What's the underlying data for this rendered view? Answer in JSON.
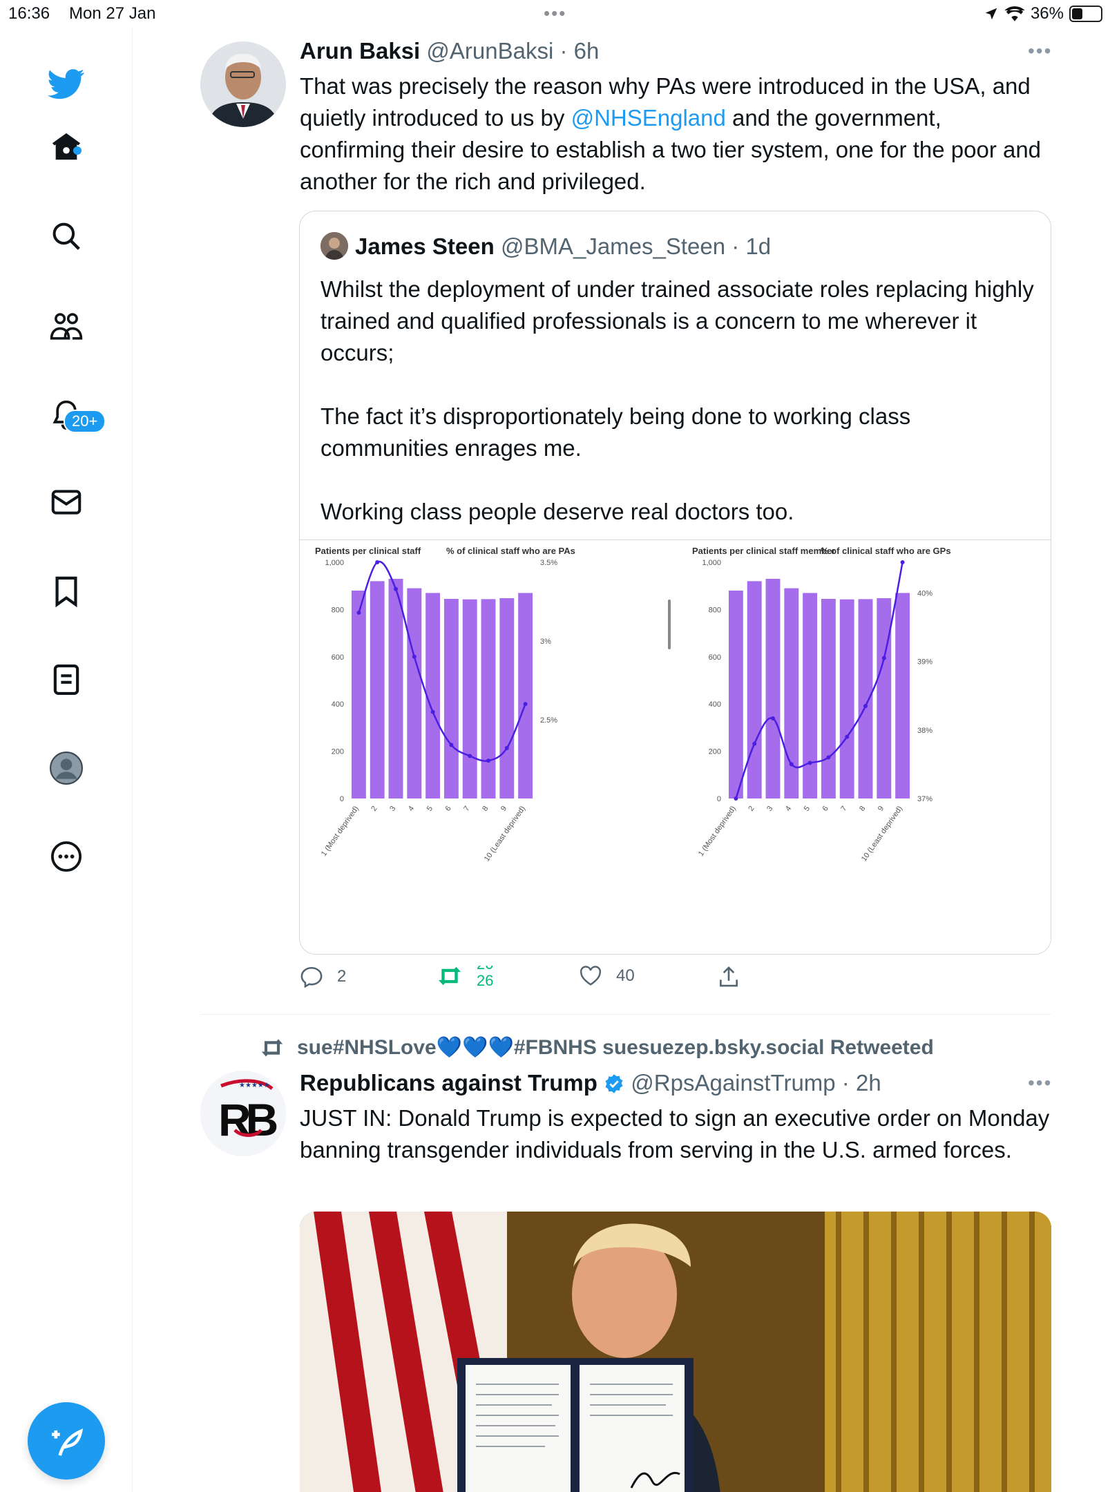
{
  "status_bar": {
    "time": "16:36",
    "date": "Mon 27 Jan",
    "battery": "36%",
    "battery_level": 0.36
  },
  "sidebar": {
    "notifications_badge": "20+",
    "items": [
      "home",
      "explore",
      "communities",
      "notifications",
      "messages",
      "bookmarks",
      "lists",
      "profile",
      "more"
    ]
  },
  "tweet1": {
    "name": "Arun Baksi",
    "handle": "@ArunBaksi",
    "time": "6h",
    "text_1": "That was precisely the reason why PAs were introduced in the USA, and quietly introduced to us by ",
    "mention": "@NHSEngland",
    "text_2": " and the government, confirming their desire to establish a two tier system, one for the poor and another for the rich and privileged.",
    "quote": {
      "name": "James Steen",
      "handle": "@BMA_James_Steen",
      "time": "1d",
      "text": "Whilst the deployment of under trained associate roles replacing highly trained and qualified professionals is a concern to me wherever it occurs;\n\nThe fact it’s disproportionately being done to working class communities enrages me.\n\nWorking class people deserve real doctors too."
    },
    "replies": "2",
    "retweets_top": "20",
    "retweets_bottom": "26",
    "likes": "40"
  },
  "chart_data": [
    {
      "type": "bar",
      "title_left": "Patients per clinical staff",
      "title_right": "% of clinical staff who are PAs",
      "categories": [
        "1 (Most deprived)",
        "2",
        "3",
        "4",
        "5",
        "6",
        "7",
        "8",
        "9",
        "10 (Least deprived)"
      ],
      "category_labels": [
        "1 (Most deprived)",
        "2",
        "3",
        "4",
        "5",
        "6",
        "7",
        "8",
        "9",
        "10 (Least deprived)"
      ],
      "series": [
        {
          "values": [
            880,
            920,
            930,
            890,
            870,
            845,
            843,
            844,
            848,
            870
          ]
        },
        {
          "values": [
            3.18,
            3.5,
            3.33,
            2.9,
            2.55,
            2.34,
            2.27,
            2.24,
            2.32,
            2.6
          ]
        }
      ],
      "ylim": [
        0,
        1000
      ],
      "y_ticks": [
        "0",
        "200",
        "400",
        "600",
        "800",
        "1,000"
      ],
      "y2lim": [
        2.0,
        3.5
      ],
      "y2_ticks": [
        "2.5%",
        "3%",
        "3.5%"
      ],
      "y2_tick_values": [
        2.5,
        3.0,
        3.5
      ]
    },
    {
      "type": "bar",
      "title_left": "Patients per clinical staff member",
      "title_right": "% of clinical staff who are GPs",
      "categories": [
        "1 (Most deprived)",
        "2",
        "3",
        "4",
        "5",
        "6",
        "7",
        "8",
        "9",
        "10 (Least deprived)"
      ],
      "category_labels": [
        "1 (Most deprived)",
        "2",
        "3",
        "4",
        "5",
        "6",
        "7",
        "8",
        "9",
        "10 (Least deprived)"
      ],
      "series": [
        {
          "values": [
            880,
            920,
            930,
            890,
            870,
            845,
            843,
            844,
            848,
            870
          ]
        },
        {
          "values": [
            37.0,
            37.8,
            38.17,
            37.5,
            37.52,
            37.6,
            37.9,
            38.35,
            39.05,
            40.45
          ]
        }
      ],
      "ylim": [
        0,
        1000
      ],
      "y_ticks": [
        "0",
        "200",
        "400",
        "600",
        "800",
        "1,000"
      ],
      "y2lim": [
        37.0,
        40.45
      ],
      "y2_ticks": [
        "37%",
        "38%",
        "39%",
        "40%"
      ],
      "y2_tick_values": [
        37,
        38,
        39,
        40
      ]
    }
  ],
  "retweet_banner": {
    "text_before": "sue#NHSLove",
    "hearts": "💙💙💙",
    "text_after": "#FBNHS suesuezep.bsky.social Retweeted"
  },
  "tweet2": {
    "name": "Republicans against Trump",
    "handle": "@RpsAgainstTrump",
    "time": "2h",
    "avatar_text": "RB",
    "text": "JUST IN: Donald Trump is expected to sign an executive order on Monday banning transgender individuals from serving in the U.S. armed forces."
  },
  "colors": {
    "accent": "#1d9bf0",
    "bar": "#a56cec",
    "line": "#4b1fe0",
    "retweet": "#00ba7c"
  }
}
